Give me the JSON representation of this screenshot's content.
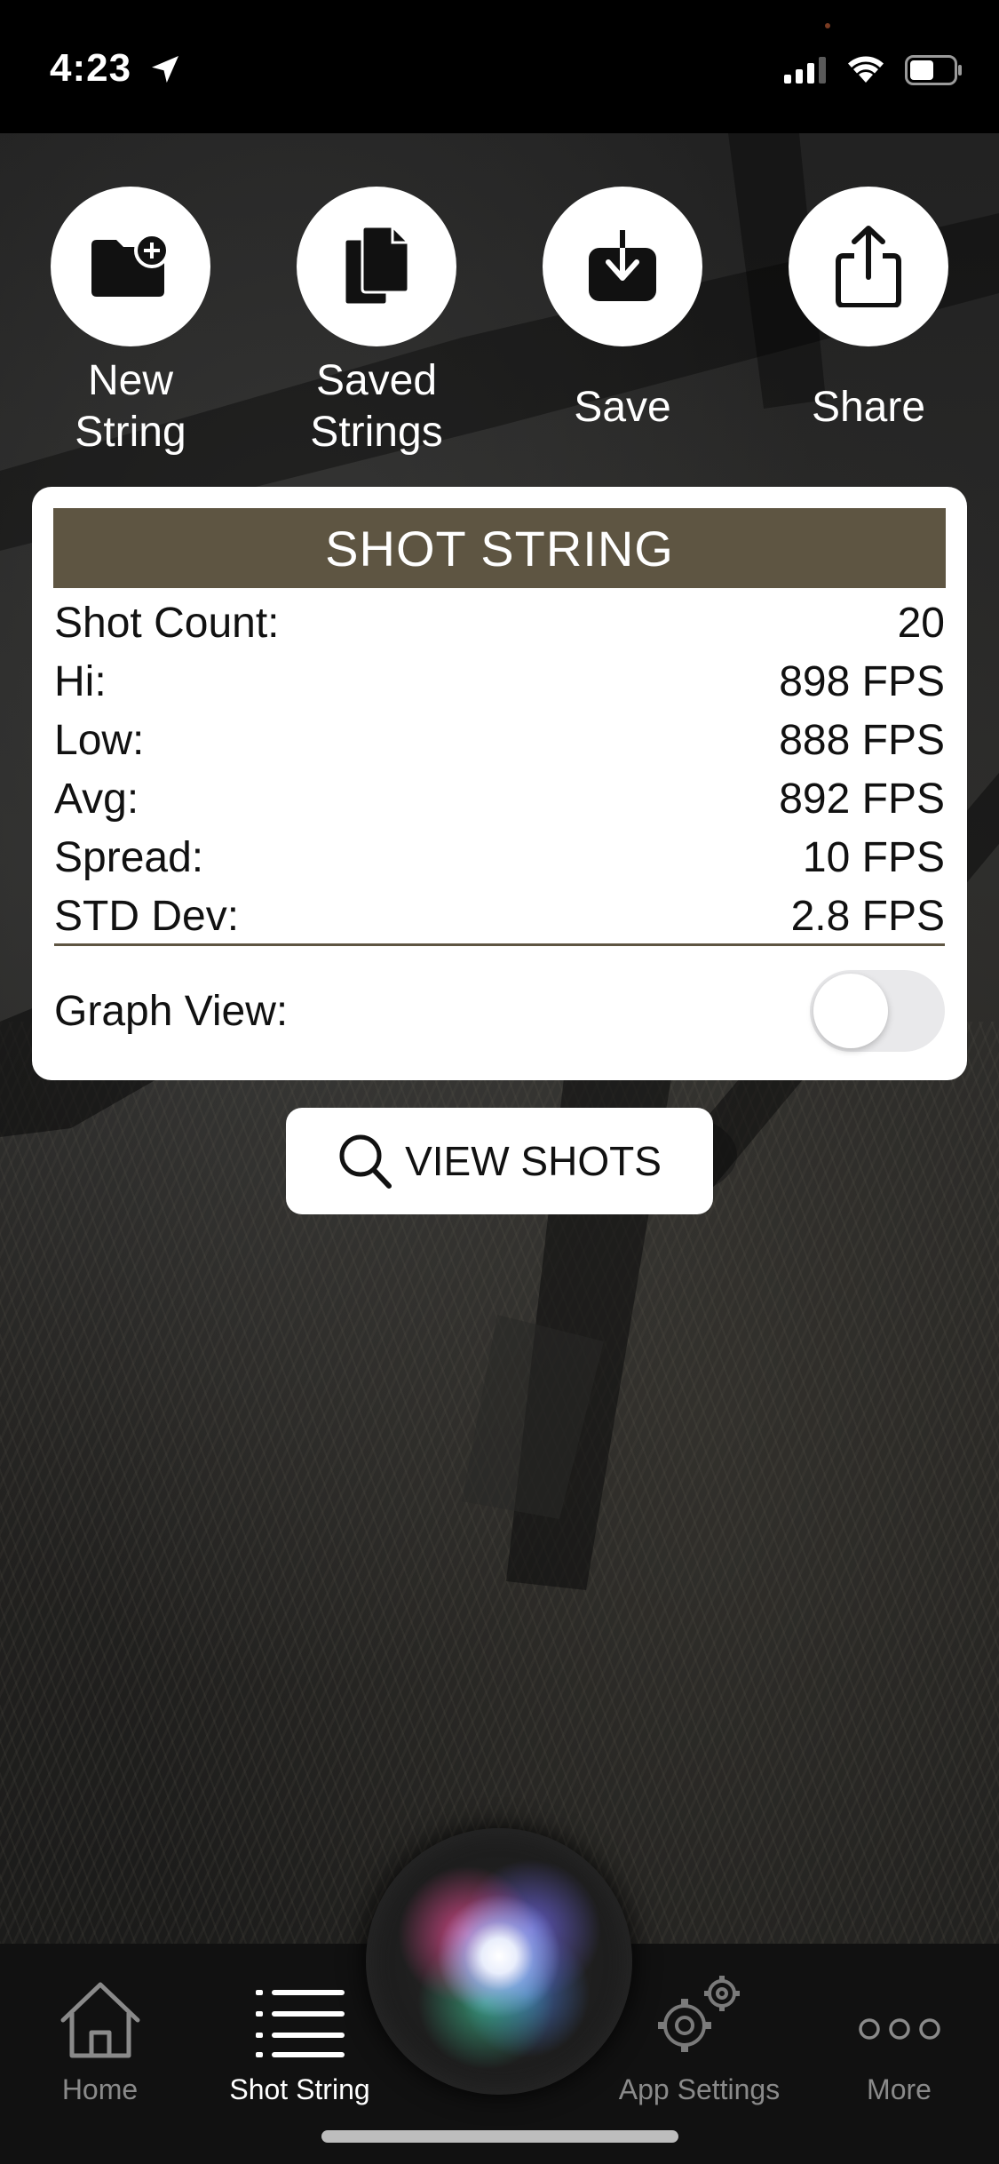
{
  "status_bar": {
    "time": "4:23"
  },
  "actions": [
    {
      "label_line1": "New",
      "label_line2": "String",
      "icon": "folder-plus-icon"
    },
    {
      "label_line1": "Saved",
      "label_line2": "Strings",
      "icon": "documents-icon"
    },
    {
      "label": "Save",
      "icon": "download-icon"
    },
    {
      "label": "Share",
      "icon": "share-icon"
    }
  ],
  "card": {
    "title": "SHOT STRING",
    "stats": [
      {
        "label": "Shot Count:",
        "value": "20"
      },
      {
        "label": "Hi:",
        "value": "898 FPS"
      },
      {
        "label": "Low:",
        "value": "888 FPS"
      },
      {
        "label": "Avg:",
        "value": "892 FPS"
      },
      {
        "label": "Spread:",
        "value": "10 FPS"
      },
      {
        "label": "STD Dev:",
        "value": "2.8 FPS"
      }
    ],
    "graph_view_label": "Graph View:",
    "graph_view_on": false
  },
  "view_shots_label": "VIEW SHOTS",
  "tabs": [
    {
      "label": "Home",
      "icon": "home-icon",
      "active": false
    },
    {
      "label": "Shot String",
      "icon": "list-icon",
      "active": true
    },
    {
      "label": "App Settings",
      "icon": "gear-icon",
      "active": false
    },
    {
      "label": "More",
      "icon": "more-icon",
      "active": false
    }
  ],
  "colors": {
    "header": "#5e5542",
    "card_bg": "#ffffff",
    "tab_inactive": "#8a8a8a",
    "tab_active": "#ffffff"
  }
}
